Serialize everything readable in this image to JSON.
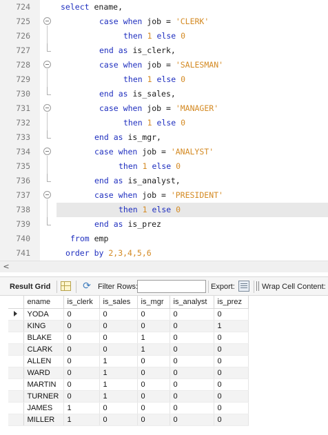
{
  "editor": {
    "lines": [
      {
        "num": "724",
        "fold": "none",
        "indent": 88,
        "tokens": [
          {
            "t": "select",
            "c": "kw"
          },
          {
            "t": " ename,",
            "c": "ident"
          }
        ]
      },
      {
        "num": "725",
        "fold": "open",
        "indent": 144,
        "tokens": [
          {
            "t": "case",
            "c": "kw"
          },
          {
            "t": " ",
            "c": "ident"
          },
          {
            "t": "when",
            "c": "kw"
          },
          {
            "t": " job = ",
            "c": "ident"
          },
          {
            "t": "'CLERK'",
            "c": "str"
          }
        ]
      },
      {
        "num": "726",
        "fold": "none",
        "indent": 179,
        "tokens": [
          {
            "t": "then",
            "c": "kw"
          },
          {
            "t": " ",
            "c": "ident"
          },
          {
            "t": "1",
            "c": "num"
          },
          {
            "t": " ",
            "c": "ident"
          },
          {
            "t": "else",
            "c": "kw"
          },
          {
            "t": " ",
            "c": "ident"
          },
          {
            "t": "0",
            "c": "num"
          }
        ]
      },
      {
        "num": "727",
        "fold": "end",
        "indent": 144,
        "tokens": [
          {
            "t": "end",
            "c": "kw"
          },
          {
            "t": " ",
            "c": "ident"
          },
          {
            "t": "as",
            "c": "kw"
          },
          {
            "t": " is_clerk,",
            "c": "ident"
          }
        ]
      },
      {
        "num": "728",
        "fold": "open",
        "indent": 144,
        "tokens": [
          {
            "t": "case",
            "c": "kw"
          },
          {
            "t": " ",
            "c": "ident"
          },
          {
            "t": "when",
            "c": "kw"
          },
          {
            "t": " job = ",
            "c": "ident"
          },
          {
            "t": "'SALESMAN'",
            "c": "str"
          }
        ]
      },
      {
        "num": "729",
        "fold": "none",
        "indent": 179,
        "tokens": [
          {
            "t": "then",
            "c": "kw"
          },
          {
            "t": " ",
            "c": "ident"
          },
          {
            "t": "1",
            "c": "num"
          },
          {
            "t": " ",
            "c": "ident"
          },
          {
            "t": "else",
            "c": "kw"
          },
          {
            "t": " ",
            "c": "ident"
          },
          {
            "t": "0",
            "c": "num"
          }
        ]
      },
      {
        "num": "730",
        "fold": "end",
        "indent": 144,
        "tokens": [
          {
            "t": "end",
            "c": "kw"
          },
          {
            "t": " ",
            "c": "ident"
          },
          {
            "t": "as",
            "c": "kw"
          },
          {
            "t": " is_sales,",
            "c": "ident"
          }
        ]
      },
      {
        "num": "731",
        "fold": "open",
        "indent": 144,
        "tokens": [
          {
            "t": "case",
            "c": "kw"
          },
          {
            "t": " ",
            "c": "ident"
          },
          {
            "t": "when",
            "c": "kw"
          },
          {
            "t": " job = ",
            "c": "ident"
          },
          {
            "t": "'MANAGER'",
            "c": "str"
          }
        ]
      },
      {
        "num": "732",
        "fold": "none",
        "indent": 179,
        "tokens": [
          {
            "t": "then",
            "c": "kw"
          },
          {
            "t": " ",
            "c": "ident"
          },
          {
            "t": "1",
            "c": "num"
          },
          {
            "t": " ",
            "c": "ident"
          },
          {
            "t": "else",
            "c": "kw"
          },
          {
            "t": " ",
            "c": "ident"
          },
          {
            "t": "0",
            "c": "num"
          }
        ]
      },
      {
        "num": "733",
        "fold": "end",
        "indent": 137,
        "tokens": [
          {
            "t": "end",
            "c": "kw"
          },
          {
            "t": " ",
            "c": "ident"
          },
          {
            "t": "as",
            "c": "kw"
          },
          {
            "t": " is_mgr,",
            "c": "ident"
          }
        ]
      },
      {
        "num": "734",
        "fold": "open",
        "indent": 137,
        "tokens": [
          {
            "t": "case",
            "c": "kw"
          },
          {
            "t": " ",
            "c": "ident"
          },
          {
            "t": "when",
            "c": "kw"
          },
          {
            "t": " job = ",
            "c": "ident"
          },
          {
            "t": "'ANALYST'",
            "c": "str"
          }
        ]
      },
      {
        "num": "735",
        "fold": "none",
        "indent": 172,
        "tokens": [
          {
            "t": "then",
            "c": "kw"
          },
          {
            "t": " ",
            "c": "ident"
          },
          {
            "t": "1",
            "c": "num"
          },
          {
            "t": " ",
            "c": "ident"
          },
          {
            "t": "else",
            "c": "kw"
          },
          {
            "t": " ",
            "c": "ident"
          },
          {
            "t": "0",
            "c": "num"
          }
        ]
      },
      {
        "num": "736",
        "fold": "end",
        "indent": 137,
        "tokens": [
          {
            "t": "end",
            "c": "kw"
          },
          {
            "t": " ",
            "c": "ident"
          },
          {
            "t": "as",
            "c": "kw"
          },
          {
            "t": " is_analyst,",
            "c": "ident"
          }
        ]
      },
      {
        "num": "737",
        "fold": "open",
        "indent": 137,
        "tokens": [
          {
            "t": "case",
            "c": "kw"
          },
          {
            "t": " ",
            "c": "ident"
          },
          {
            "t": "when",
            "c": "kw"
          },
          {
            "t": " job = ",
            "c": "ident"
          },
          {
            "t": "'PRESIDENT'",
            "c": "str"
          }
        ]
      },
      {
        "num": "738",
        "fold": "none",
        "indent": 172,
        "current": true,
        "tokens": [
          {
            "t": "then",
            "c": "kw"
          },
          {
            "t": " ",
            "c": "ident"
          },
          {
            "t": "1",
            "c": "num"
          },
          {
            "t": " ",
            "c": "ident"
          },
          {
            "t": "else",
            "c": "kw"
          },
          {
            "t": " ",
            "c": "ident"
          },
          {
            "t": "0",
            "c": "num"
          }
        ]
      },
      {
        "num": "739",
        "fold": "end",
        "indent": 137,
        "tokens": [
          {
            "t": "end",
            "c": "kw"
          },
          {
            "t": " ",
            "c": "ident"
          },
          {
            "t": "as",
            "c": "kw"
          },
          {
            "t": " is_prez",
            "c": "ident"
          }
        ]
      },
      {
        "num": "740",
        "fold": "none",
        "indent": 102,
        "tokens": [
          {
            "t": "from",
            "c": "kw"
          },
          {
            "t": " emp",
            "c": "ident"
          }
        ]
      },
      {
        "num": "741",
        "fold": "none",
        "indent": 95,
        "tokens": [
          {
            "t": "order",
            "c": "kw"
          },
          {
            "t": " ",
            "c": "ident"
          },
          {
            "t": "by",
            "c": "kw"
          },
          {
            "t": " ",
            "c": "ident"
          },
          {
            "t": "2,3,4,5,6",
            "c": "num"
          }
        ]
      }
    ]
  },
  "hscroll": {
    "left_arrow": "<"
  },
  "toolbar": {
    "result_tab_label": "Result Grid",
    "filter_label": "Filter Rows:",
    "filter_value": "",
    "export_label": "Export:",
    "wrap_label": "Wrap Cell Content:"
  },
  "grid": {
    "columns": [
      "ename",
      "is_clerk",
      "is_sales",
      "is_mgr",
      "is_analyst",
      "is_prez"
    ],
    "rows": [
      [
        "YODA",
        "0",
        "0",
        "0",
        "0",
        "0"
      ],
      [
        "KING",
        "0",
        "0",
        "0",
        "0",
        "1"
      ],
      [
        "BLAKE",
        "0",
        "0",
        "1",
        "0",
        "0"
      ],
      [
        "CLARK",
        "0",
        "0",
        "1",
        "0",
        "0"
      ],
      [
        "ALLEN",
        "0",
        "1",
        "0",
        "0",
        "0"
      ],
      [
        "WARD",
        "0",
        "1",
        "0",
        "0",
        "0"
      ],
      [
        "MARTIN",
        "0",
        "1",
        "0",
        "0",
        "0"
      ],
      [
        "TURNER",
        "0",
        "1",
        "0",
        "0",
        "0"
      ],
      [
        "JAMES",
        "1",
        "0",
        "0",
        "0",
        "0"
      ],
      [
        "MILLER",
        "1",
        "0",
        "0",
        "0",
        "0"
      ]
    ],
    "selected_row": 0
  },
  "colors": {
    "keyword": "#1f2fbf",
    "string": "#d48a23",
    "number": "#d48a23",
    "gutter": "#f2f2f2",
    "current_line": "#e8e8e8"
  }
}
